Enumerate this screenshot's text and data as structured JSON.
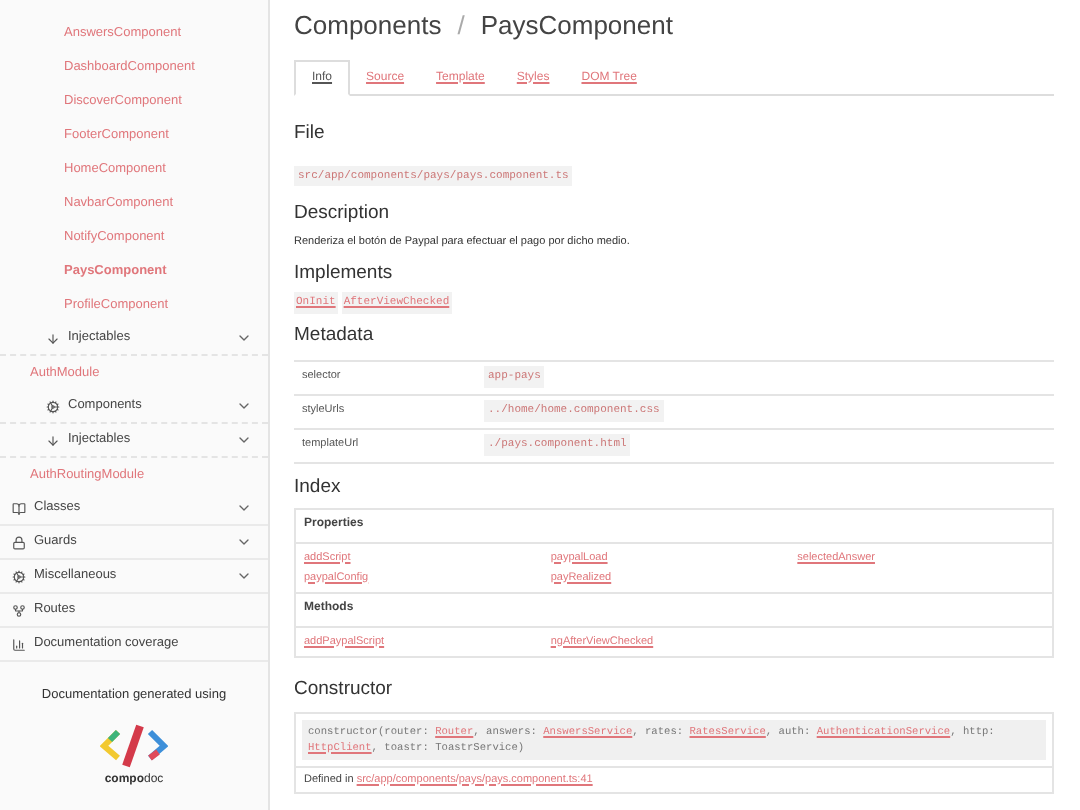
{
  "sidebar": {
    "component_links": [
      {
        "label": "AnswersComponent",
        "selected": false
      },
      {
        "label": "DashboardComponent",
        "selected": false
      },
      {
        "label": "DiscoverComponent",
        "selected": false
      },
      {
        "label": "FooterComponent",
        "selected": false
      },
      {
        "label": "HomeComponent",
        "selected": false
      },
      {
        "label": "NavbarComponent",
        "selected": false
      },
      {
        "label": "NotifyComponent",
        "selected": false
      },
      {
        "label": "PaysComponent",
        "selected": true
      },
      {
        "label": "ProfileComponent",
        "selected": false
      }
    ],
    "injectables": {
      "kind": "injectables",
      "label": "Injectables"
    },
    "modules": [
      {
        "label": "AuthModule",
        "children": [
          {
            "kind": "components",
            "label": "Components"
          },
          {
            "kind": "injectables",
            "label": "Injectables"
          }
        ]
      },
      {
        "label": "AuthRoutingModule"
      }
    ],
    "menu": [
      {
        "kind": "classes",
        "label": "Classes",
        "expandable": true
      },
      {
        "kind": "guards",
        "label": "Guards",
        "expandable": true
      },
      {
        "kind": "miscellaneous",
        "label": "Miscellaneous",
        "expandable": true
      },
      {
        "kind": "routes",
        "label": "Routes",
        "expandable": false
      },
      {
        "kind": "coverage",
        "label": "Documentation coverage",
        "expandable": false
      }
    ],
    "footer": {
      "text": "Documentation generated using",
      "logo_text": "**compo**doc"
    }
  },
  "breadcrumb": [
    "Components",
    "PaysComponent"
  ],
  "breadcrumb_separator": "/",
  "tabs": [
    {
      "label": "Info",
      "selected": true
    },
    {
      "label": "Source",
      "selected": false
    },
    {
      "label": "Template",
      "selected": false
    },
    {
      "label": "Styles",
      "selected": false
    },
    {
      "label": "DOM Tree",
      "selected": false
    }
  ],
  "file": {
    "heading": "File",
    "path": "src/app/components/pays/pays.component.ts"
  },
  "description": {
    "heading": "Description",
    "text": "Renderiza el botón de Paypal para efectuar el pago por dicho medio."
  },
  "implements": {
    "heading": "Implements",
    "items": [
      "OnInit",
      "AfterViewChecked"
    ]
  },
  "metadata": {
    "heading": "Metadata",
    "rows": [
      {
        "key": "selector",
        "value": "app-pays"
      },
      {
        "key": "styleUrls",
        "value": "../home/home.component.css"
      },
      {
        "key": "templateUrl",
        "value": "./pays.component.html"
      }
    ]
  },
  "index": {
    "heading": "Index",
    "sections": [
      {
        "title": "Properties",
        "items": [
          "addScript",
          "paypalLoad",
          "selectedAnswer",
          "paypalConfig",
          "payRealized"
        ]
      },
      {
        "title": "Methods",
        "items": [
          "addPaypalScript",
          "ngAfterViewChecked"
        ]
      }
    ]
  },
  "constructor": {
    "heading": "Constructor",
    "signature": [
      {
        "kind": "text",
        "text": "constructor(router: "
      },
      {
        "kind": "link",
        "text": "Router"
      },
      {
        "kind": "text",
        "text": ", answers: "
      },
      {
        "kind": "link",
        "text": "AnswersService"
      },
      {
        "kind": "text",
        "text": ", rates: "
      },
      {
        "kind": "link",
        "text": "RatesService"
      },
      {
        "kind": "text",
        "text": ", auth: "
      },
      {
        "kind": "link",
        "text": "AuthenticationService"
      },
      {
        "kind": "text",
        "text": ", http: "
      },
      {
        "kind": "link",
        "text": "HttpClient"
      },
      {
        "kind": "text",
        "text": ", toastr: ToastrService)"
      }
    ],
    "defined_in": {
      "text": "Defined in",
      "link": "src/app/components/pays/pays.component.ts:41"
    }
  }
}
